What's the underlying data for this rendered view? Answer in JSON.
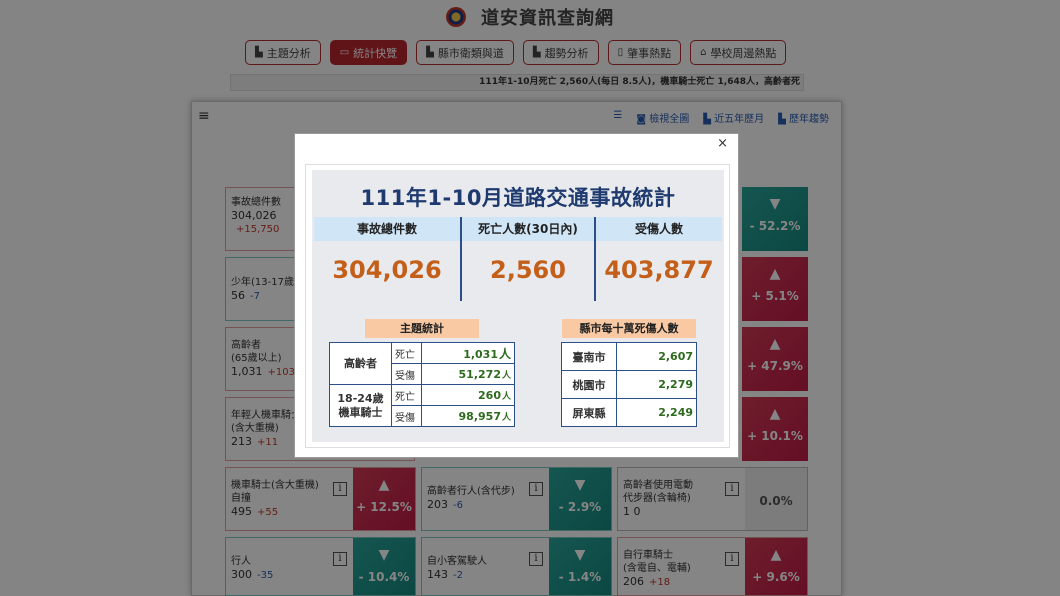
{
  "site": {
    "title": "道安資訊查詢網"
  },
  "nav": [
    {
      "label": "主題分析",
      "icon": "chart-icon",
      "active": false
    },
    {
      "label": "統計快覽",
      "icon": "dashboard-icon",
      "active": true
    },
    {
      "label": "縣市衛類與道",
      "icon": "chart-icon",
      "active": false
    },
    {
      "label": "趨勢分析",
      "icon": "chart-icon",
      "active": false
    },
    {
      "label": "肇事熱點",
      "icon": "map-icon",
      "active": false
    },
    {
      "label": "學校周邊熱點",
      "icon": "school-icon",
      "active": false
    }
  ],
  "ticker": "111年1-10月死亡 2,560人(每日 8.5人)，機車騎士死亡 1,648人，高齡者死",
  "panel_tools": {
    "list": "☰",
    "screenshot": "檢視全圖",
    "five_year": "近五年歷月",
    "history": "歷年趨勢"
  },
  "cards": [
    {
      "line1": "事故總件數",
      "value": "304,026",
      "change": "+15,750",
      "dir": "inc"
    },
    {
      "line1": "少年(13-17歲",
      "value": "56",
      "change": "-7",
      "dir": "dec"
    },
    {
      "line1": "高齡者",
      "line2": "(65歲以上)",
      "value": "1,031",
      "change": "+103",
      "dir": "inc"
    },
    {
      "line1": "年輕人機車騎士",
      "line2": "(含大重機)",
      "value": "213",
      "change": "+11",
      "dir": "inc"
    },
    {
      "line1": "機車騎士(含大重機)",
      "line2": "自撞",
      "value": "495",
      "change": "+55",
      "dir": "inc",
      "pct": "+ 12.5%",
      "trend": "up"
    },
    {
      "line1": "高齡者行人(含代步)",
      "value": "203",
      "change": "-6",
      "dir": "dec",
      "pct": "- 2.9%",
      "trend": "down"
    },
    {
      "line1": "高齡者使用電動",
      "line2": "代步器(含輪椅)",
      "value": "1 0",
      "change": "",
      "dir": "dec",
      "pct": "0.0%",
      "trend": "flat"
    },
    {
      "line1": "行人",
      "value": "300",
      "change": "-35",
      "dir": "dec",
      "pct": "- 10.4%",
      "trend": "down"
    },
    {
      "line1": "自小客駕駛人",
      "value": "143",
      "change": "-2",
      "dir": "dec",
      "pct": "- 1.4%",
      "trend": "down"
    },
    {
      "line1": "自行車騎士",
      "line2": "(含電自、電輔)",
      "value": "206",
      "change": "+18",
      "dir": "inc",
      "pct": "+ 9.6%",
      "trend": "up"
    }
  ],
  "right_edge": [
    {
      "pct": "- 52.2%",
      "trend": "down"
    },
    {
      "pct": "+ 5.1%",
      "trend": "up"
    },
    {
      "pct": "+ 47.9%",
      "trend": "up"
    },
    {
      "pct": "+ 10.1%",
      "trend": "up"
    }
  ],
  "modal": {
    "close": "×",
    "title": "111年1-10月道路交通事故統計",
    "stats": [
      {
        "label": "事故總件數",
        "value": "304,026"
      },
      {
        "label": "死亡人數(30日內)",
        "value": "2,560"
      },
      {
        "label": "受傷人數",
        "value": "403,877"
      }
    ],
    "theme_label": "主題統計",
    "theme_rows": [
      {
        "group": "高齡者",
        "kind": "死亡",
        "value": "1,031",
        "unit": "人"
      },
      {
        "group": "",
        "kind": "受傷",
        "value": "51,272",
        "unit": "人"
      },
      {
        "group": "18-24歲 機車騎士",
        "kind": "死亡",
        "value": "260",
        "unit": "人"
      },
      {
        "group": "",
        "kind": "受傷",
        "value": "98,957",
        "unit": "人"
      }
    ],
    "city_label": "縣市每十萬死傷人數",
    "cities": [
      {
        "name": "臺南市",
        "value": "2,607"
      },
      {
        "name": "桃園市",
        "value": "2,279"
      },
      {
        "name": "屏東縣",
        "value": "2,249"
      }
    ]
  },
  "colors": {
    "brand_red": "#b8282f",
    "up": "#c21c48",
    "down": "#178a80",
    "title_blue": "#1e3a6e",
    "value_orange": "#c45f1a"
  }
}
